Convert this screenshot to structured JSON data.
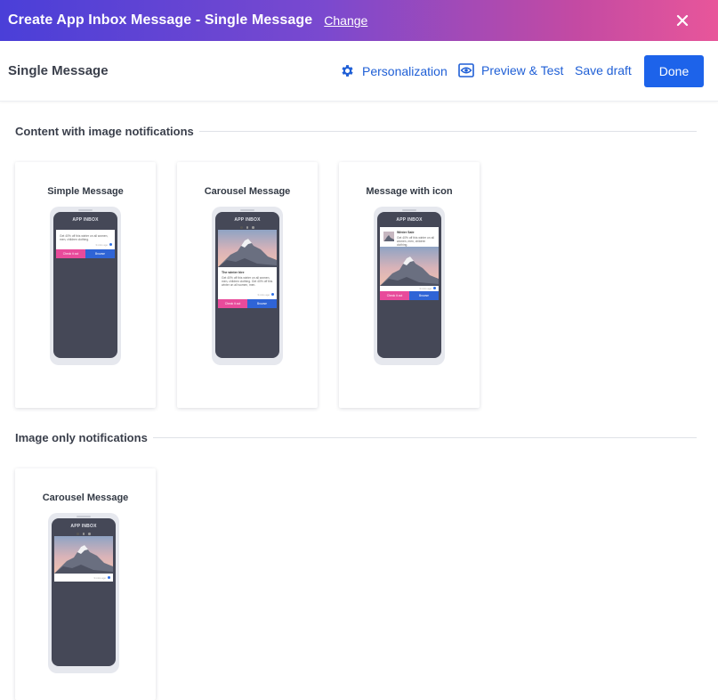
{
  "topbar": {
    "title": "Create App Inbox Message - Single Message",
    "change_label": "Change"
  },
  "subheader": {
    "title": "Single Message",
    "personalization_label": "Personalization",
    "preview_label": "Preview & Test",
    "save_draft_label": "Save draft",
    "done_label": "Done"
  },
  "sections": [
    {
      "title": "Content with image notifications",
      "cards": [
        {
          "title": "Simple Message"
        },
        {
          "title": "Carousel Message"
        },
        {
          "title": "Message with icon"
        }
      ]
    },
    {
      "title": "Image only notifications",
      "cards": [
        {
          "title": "Carousel Message"
        }
      ]
    }
  ],
  "mockup": {
    "inbox_label": "APP INBOX",
    "simple_body": "Get 40% off this winter on all women, men, children clothing.",
    "carousel_title": "The winter hire",
    "carousel_body": "Get 40% off this winter on all women, men, children clothing. Get 40% off this winter on all women, men.",
    "icon_title": "Winter Sale",
    "icon_body": "Get 40% off this winter on all women, men, children clothing.",
    "time_label": "3 mins ago",
    "btn_primary": "Check it out",
    "btn_secondary": "Browse"
  },
  "colors": {
    "gradient_start": "#4a3fd8",
    "gradient_end": "#e8569a",
    "primary": "#1d63ea",
    "link": "#1f5fd6",
    "phone_screen": "#454857",
    "cta_pink": "#e84b9b",
    "cta_blue": "#2f64d6"
  }
}
